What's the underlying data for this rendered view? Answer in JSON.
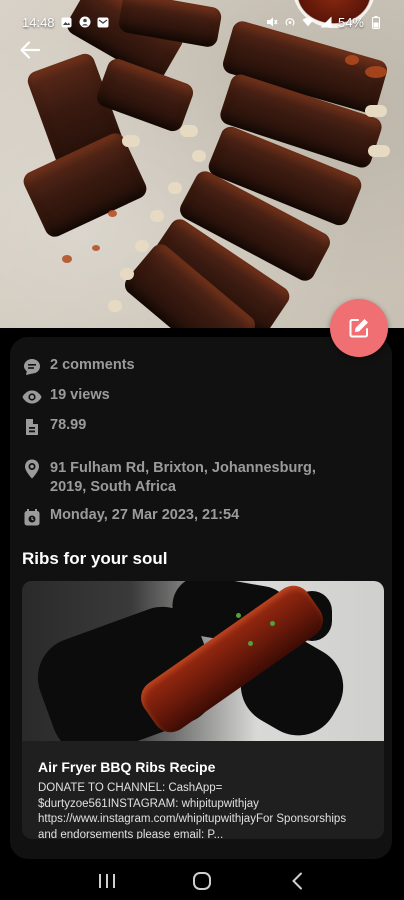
{
  "status_bar": {
    "time": "14:48",
    "battery": "54%"
  },
  "details": {
    "comments": "2 comments",
    "views": "19 views",
    "price": "78.99",
    "address": "91 Fulham Rd, Brixton, Johannesburg, 2019, South Africa",
    "date": "Monday, 27 Mar 2023, 21:54"
  },
  "section_title": "Ribs for your soul",
  "video": {
    "title": "Air Fryer BBQ Ribs Recipe",
    "description": "DONATE TO CHANNEL: CashApp= $durtyzoe561INSTAGRAM: whipitupwithjay https://www.instagram.com/whipitupwithjayFor Sponsorships and endorsements please email: P..."
  },
  "colors": {
    "fab": "#ef6f73",
    "card_background": "#111111",
    "muted_text": "#9b9b9b"
  },
  "icons": {
    "back": "arrow-left-icon",
    "edit": "edit-icon",
    "comments": "comment-icon",
    "views": "eye-icon",
    "price": "price-tag-icon",
    "location": "location-pin-icon",
    "calendar": "calendar-icon",
    "nav_recents": "recents-icon",
    "nav_home": "home-icon",
    "nav_back": "nav-back-icon"
  }
}
